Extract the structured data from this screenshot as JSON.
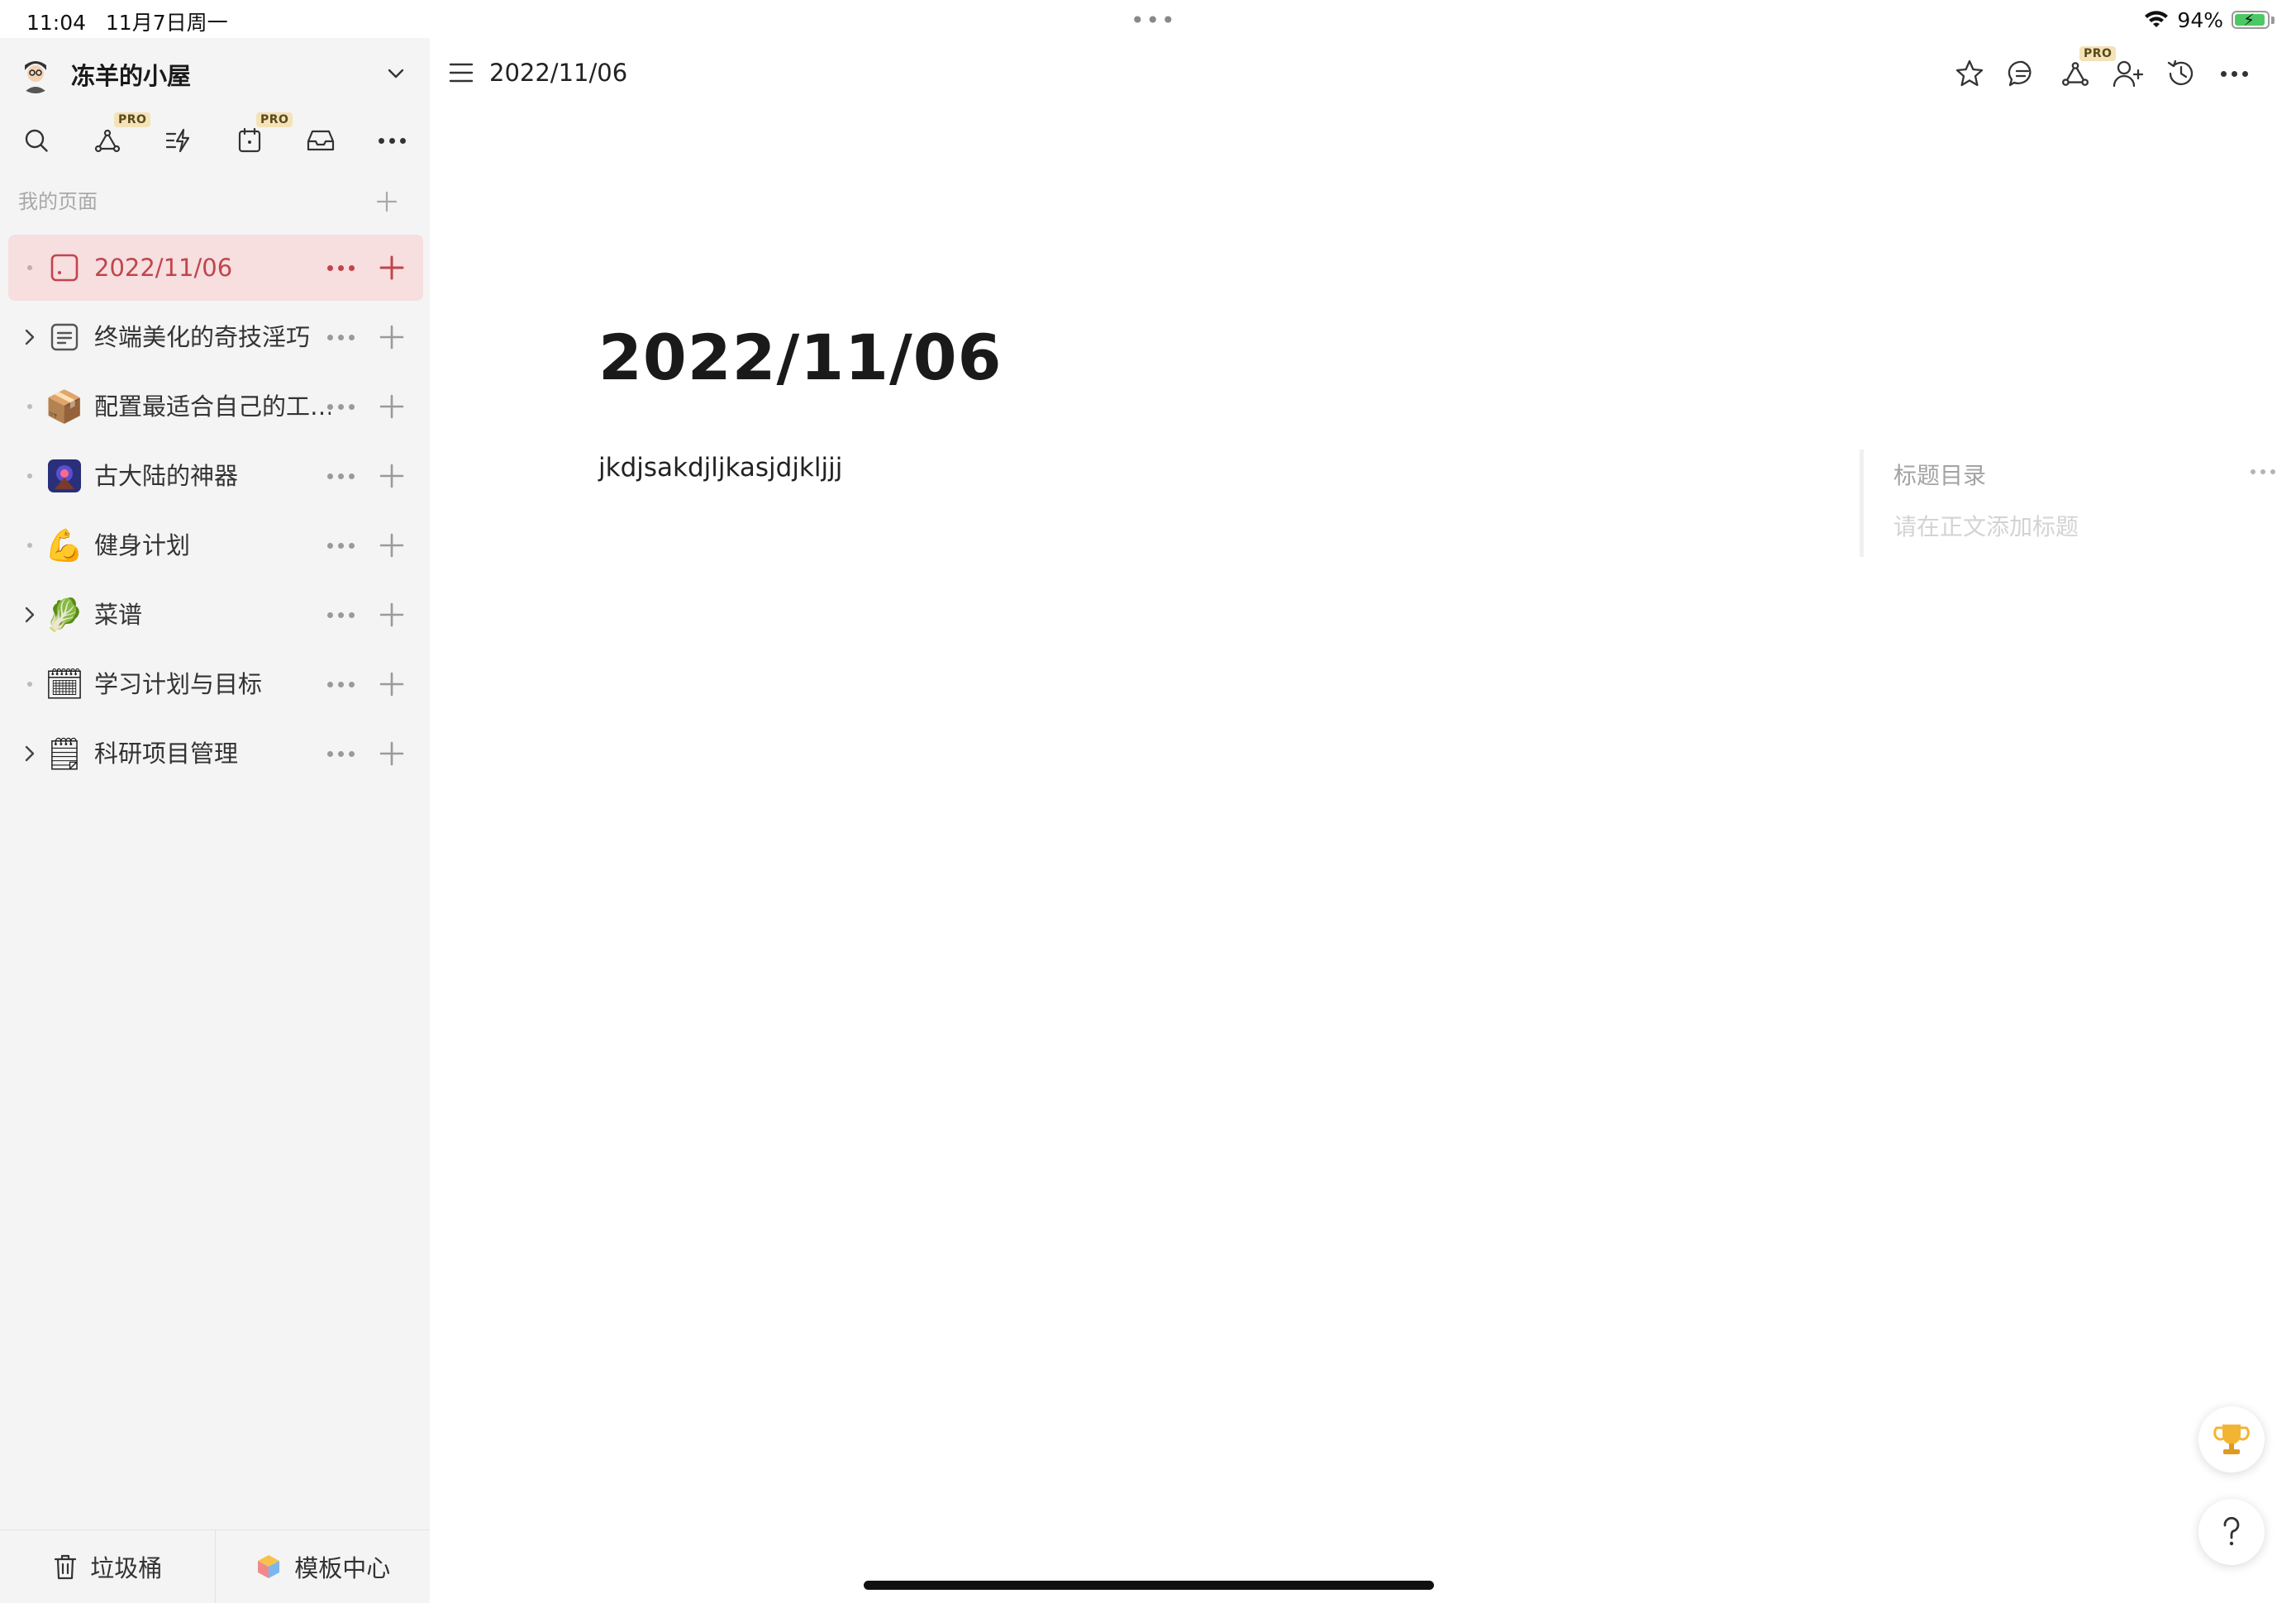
{
  "status_bar": {
    "time": "11:04",
    "date": "11月7日周一",
    "battery_percent": "94%",
    "battery_level": 0.94,
    "charging": true
  },
  "sidebar": {
    "workspace_name": "冻羊的小屋",
    "toolbar": [
      {
        "icon": "search-icon"
      },
      {
        "icon": "graph-icon",
        "badge": "PRO"
      },
      {
        "icon": "quick-actions-icon"
      },
      {
        "icon": "calendar-icon",
        "badge": "PRO"
      },
      {
        "icon": "inbox-icon"
      },
      {
        "icon": "more-icon"
      }
    ],
    "section_label": "我的页面",
    "pages": [
      {
        "label": "2022/11/06",
        "icon": "page-icon",
        "active": true,
        "expandable": false
      },
      {
        "label": "终端美化的奇技淫巧",
        "icon": "document-icon",
        "active": false,
        "expandable": true
      },
      {
        "label": "配置最适合自己的工…",
        "icon": "package-emoji",
        "emoji": "📦",
        "active": false,
        "expandable": false
      },
      {
        "label": "古大陆的神器",
        "icon": "artifact-image-icon",
        "active": false,
        "expandable": false
      },
      {
        "label": "健身计划",
        "icon": "flexed-biceps-emoji",
        "emoji": "💪",
        "active": false,
        "expandable": false
      },
      {
        "label": "菜谱",
        "icon": "leafy-green-emoji",
        "emoji": "🥬",
        "active": false,
        "expandable": true
      },
      {
        "label": "学习计划与目标",
        "icon": "calendar-emoji",
        "emoji": "🗓",
        "active": false,
        "expandable": false
      },
      {
        "label": "科研项目管理",
        "icon": "notepad-emoji",
        "emoji": "🗒",
        "active": false,
        "expandable": true
      }
    ],
    "footer": {
      "trash_label": "垃圾桶",
      "templates_label": "模板中心"
    }
  },
  "topbar": {
    "breadcrumb": "2022/11/06",
    "actions": [
      {
        "icon": "star-icon"
      },
      {
        "icon": "comment-icon"
      },
      {
        "icon": "graph-icon",
        "badge": "PRO"
      },
      {
        "icon": "add-user-icon"
      },
      {
        "icon": "history-icon"
      },
      {
        "icon": "more-icon"
      }
    ]
  },
  "document": {
    "title": "2022/11/06",
    "body": "jkdjsakdjljkasjdjkljjj"
  },
  "toc": {
    "title": "标题目录",
    "empty_hint": "请在正文添加标题"
  },
  "colors": {
    "accent": "#c0454d",
    "active_row_bg": "#f7dedf",
    "sidebar_bg": "#f4f4f4",
    "pro_badge_bg": "#f4e3b8"
  }
}
